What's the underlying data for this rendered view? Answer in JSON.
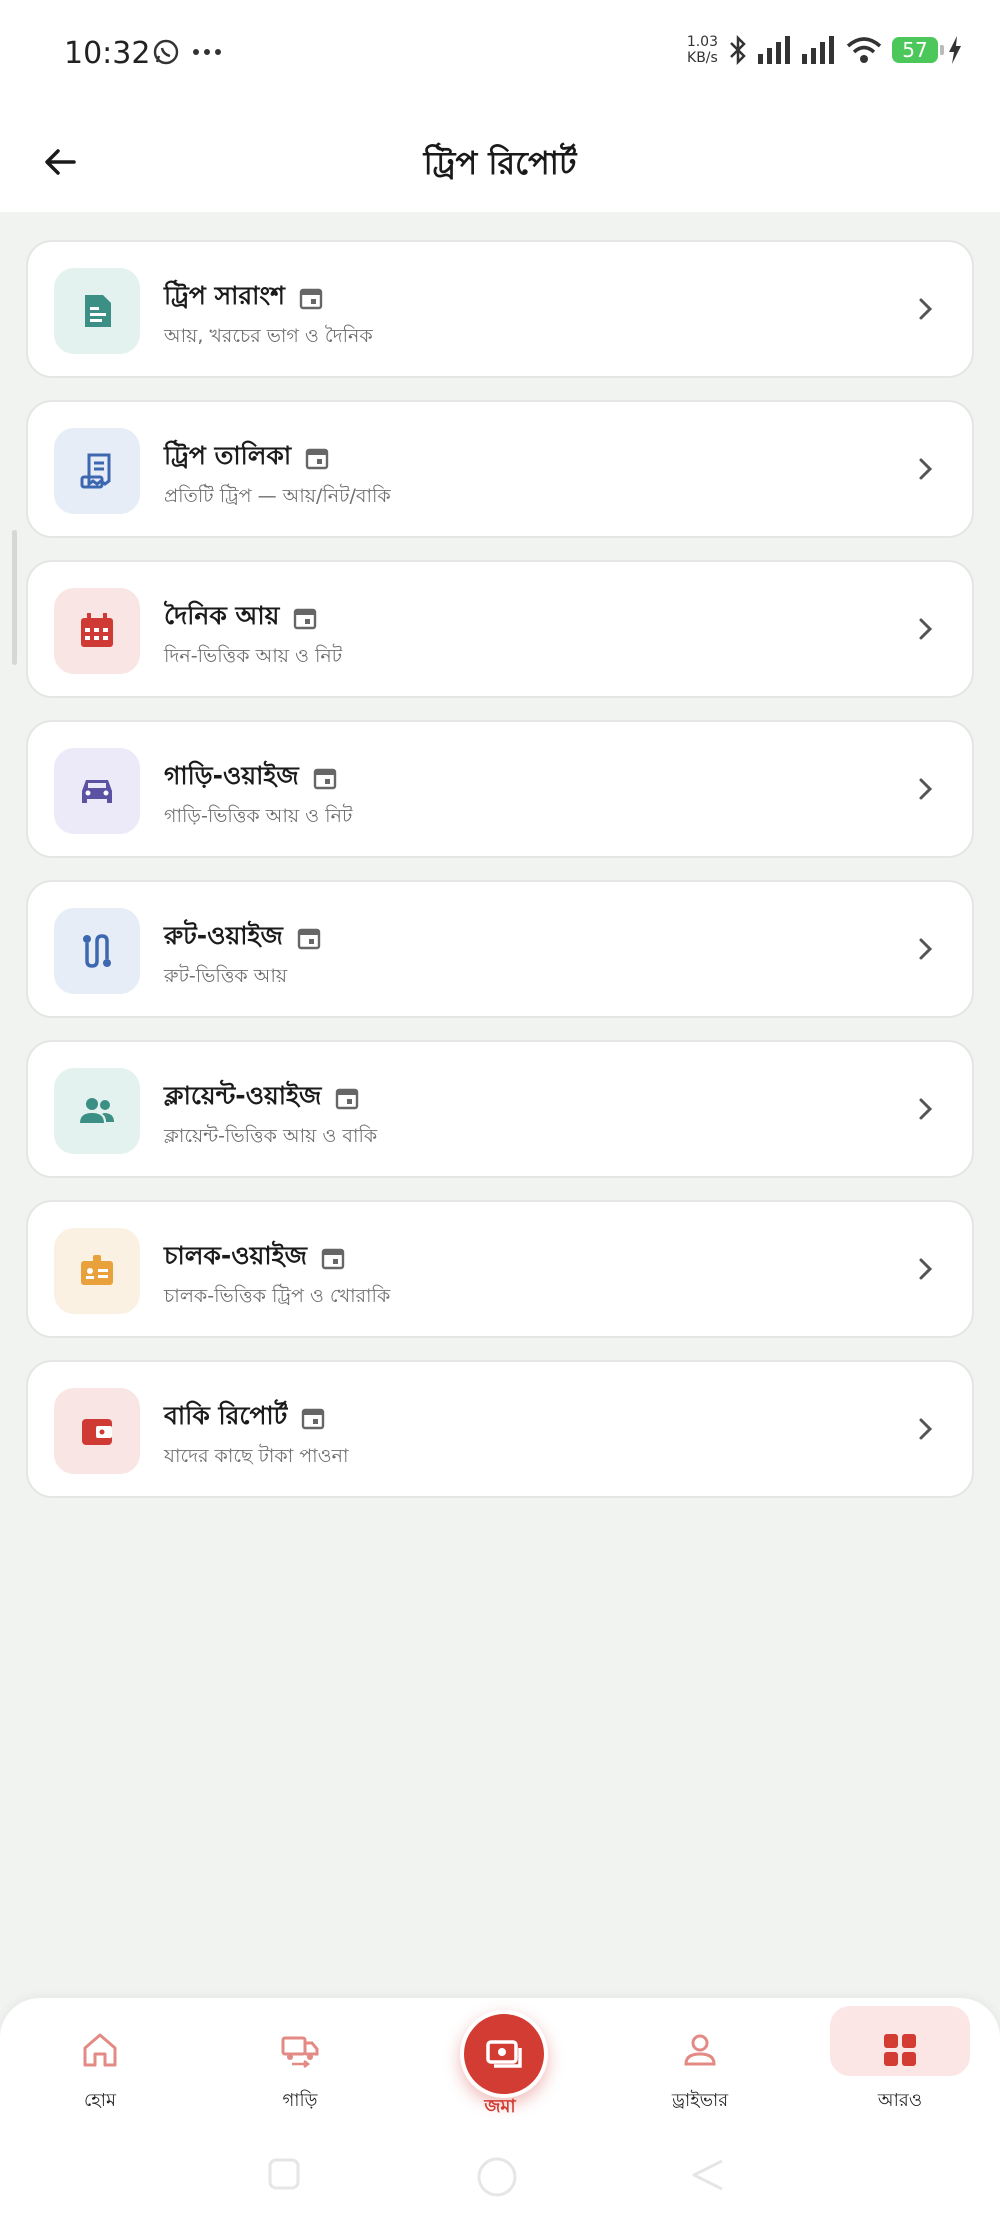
{
  "status_bar": {
    "time": "10:32",
    "net_speed_top": "1.03",
    "net_speed_bottom": "KB/s",
    "battery": "57"
  },
  "app_bar": {
    "title": "ট্রিপ রিপোর্ট",
    "back_icon": "arrow-left-icon"
  },
  "reports": [
    {
      "title": "ট্রিপ সারাংশ",
      "subtitle": "আয়, খরচের ভাগ ও দৈনিক",
      "icon": "document-icon",
      "icon_color": "#3b8f84",
      "bg": "#e3f1ef"
    },
    {
      "title": "ট্রিপ তালিকা",
      "subtitle": "প্রতিটি ট্রিপ — আয়/নিট/বাকি",
      "icon": "receipt-icon",
      "icon_color": "#3d68b0",
      "bg": "#e7edf7"
    },
    {
      "title": "দৈনিক আয়",
      "subtitle": "দিন-ভিত্তিক আয় ও নিট",
      "icon": "calendar-icon",
      "icon_color": "#d03a35",
      "bg": "#f8e5e4"
    },
    {
      "title": "গাড়ি-ওয়াইজ",
      "subtitle": "গাড়ি-ভিত্তিক আয় ও নিট",
      "icon": "car-icon",
      "icon_color": "#5b52a3",
      "bg": "#eceaf8"
    },
    {
      "title": "রুট-ওয়াইজ",
      "subtitle": "রুট-ভিত্তিক আয়",
      "icon": "route-icon",
      "icon_color": "#3d68b0",
      "bg": "#e7edf7"
    },
    {
      "title": "ক্লায়েন্ট-ওয়াইজ",
      "subtitle": "ক্লায়েন্ট-ভিত্তিক আয় ও বাকি",
      "icon": "people-icon",
      "icon_color": "#3b8f84",
      "bg": "#e3f1ef"
    },
    {
      "title": "চালক-ওয়াইজ",
      "subtitle": "চালক-ভিত্তিক ট্রিপ ও খোরাকি",
      "icon": "badge-icon",
      "icon_color": "#e9a23b",
      "bg": "#fbf1e2"
    },
    {
      "title": "বাকি রিপোর্ট",
      "subtitle": "যাদের কাছে টাকা পাওনা",
      "icon": "wallet-icon",
      "icon_color": "#d03a35",
      "bg": "#f8e5e4"
    }
  ],
  "bottom_nav": {
    "home": "হোম",
    "vehicle": "গাড়ি",
    "deposit": "জমা",
    "driver": "ড্রাইভার",
    "more": "আরও"
  },
  "colors": {
    "accent": "#d23c33",
    "background": "#f1f3f1"
  }
}
